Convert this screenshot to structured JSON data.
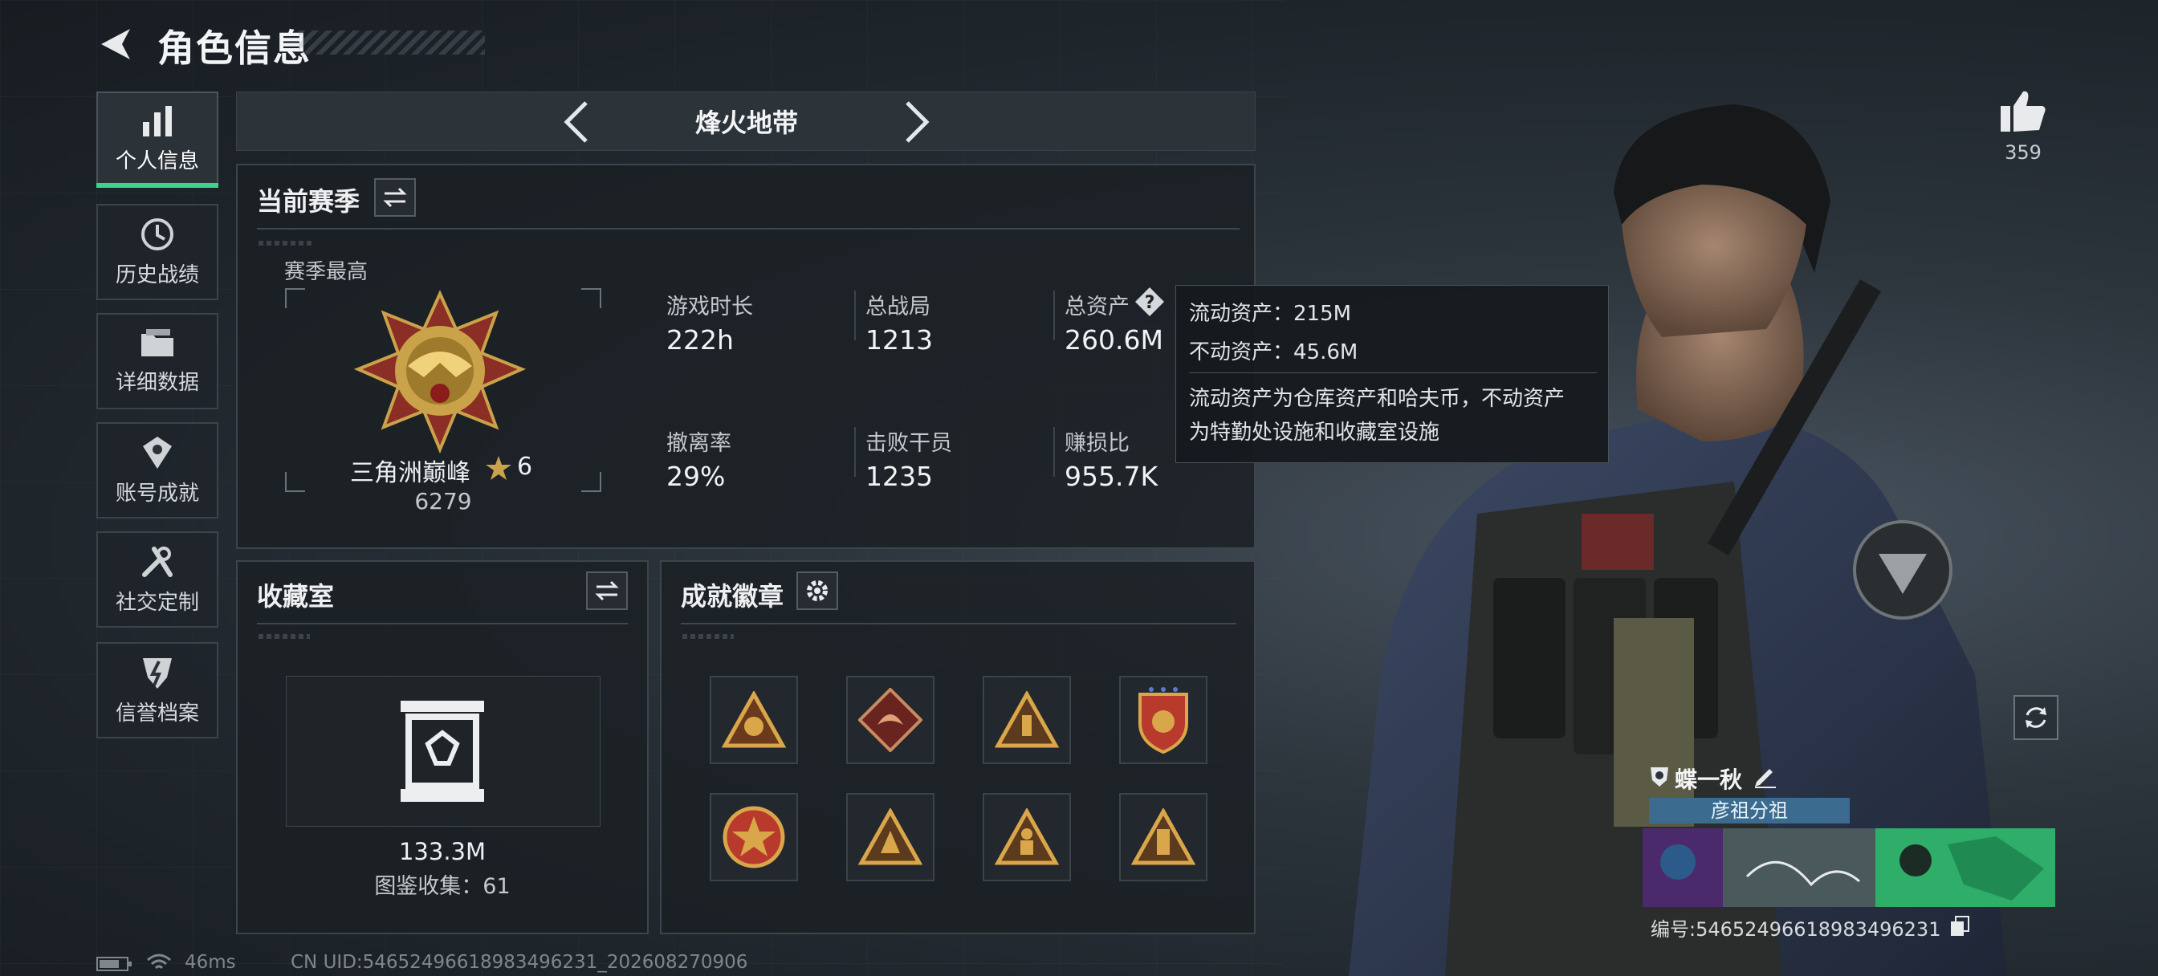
{
  "header": {
    "title": "角色信息"
  },
  "sidebar": {
    "items": [
      {
        "label": "个人信息",
        "icon": "bar-chart-icon",
        "active": true
      },
      {
        "label": "历史战绩",
        "icon": "history-icon",
        "active": false
      },
      {
        "label": "详细数据",
        "icon": "folder-icon",
        "active": false
      },
      {
        "label": "账号成就",
        "icon": "achievement-icon",
        "active": false
      },
      {
        "label": "社交定制",
        "icon": "wrench-icon",
        "active": false
      },
      {
        "label": "信誉档案",
        "icon": "shield-icon",
        "active": false
      }
    ]
  },
  "mode": {
    "title": "烽火地带"
  },
  "season": {
    "title": "当前赛季",
    "best_label": "赛季最高",
    "rank_name": "三角洲巅峰",
    "rank_stars": "6",
    "rank_score": "6279",
    "stats": [
      {
        "label": "游戏时长",
        "value": "222h"
      },
      {
        "label": "总战局",
        "value": "1213"
      },
      {
        "label": "总资产",
        "value": "260.6M"
      },
      {
        "label": "撤离率",
        "value": "29%"
      },
      {
        "label": "击败干员",
        "value": "1235"
      },
      {
        "label": "赚损比",
        "value": "955.7K"
      }
    ]
  },
  "tooltip": {
    "liquid": "流动资产：215M",
    "fixed": "不动资产：45.6M",
    "desc_line1": "流动资产为仓库资产和哈夫币，不动资产",
    "desc_line2": "为特勤处设施和收藏室设施"
  },
  "collection": {
    "title": "收藏室",
    "value": "133.3M",
    "count_label": "图鉴收集：61"
  },
  "badges": {
    "title": "成就徽章",
    "items": [
      "badge-1",
      "badge-2",
      "badge-3",
      "badge-4",
      "badge-5",
      "badge-6",
      "badge-7",
      "badge-8"
    ]
  },
  "status": {
    "ping": "46ms",
    "uid": "CN UID:54652496618983496231_202608270906"
  },
  "profile": {
    "likes": "359",
    "name": "蝶一秋",
    "group": "彦祖分祖",
    "id_label": "编号:54652496618983496231"
  },
  "colors": {
    "accent": "#3fd28a",
    "gold": "#c9a24a",
    "panel_border": "#3d454c",
    "group_bg": "#3b6c90"
  }
}
